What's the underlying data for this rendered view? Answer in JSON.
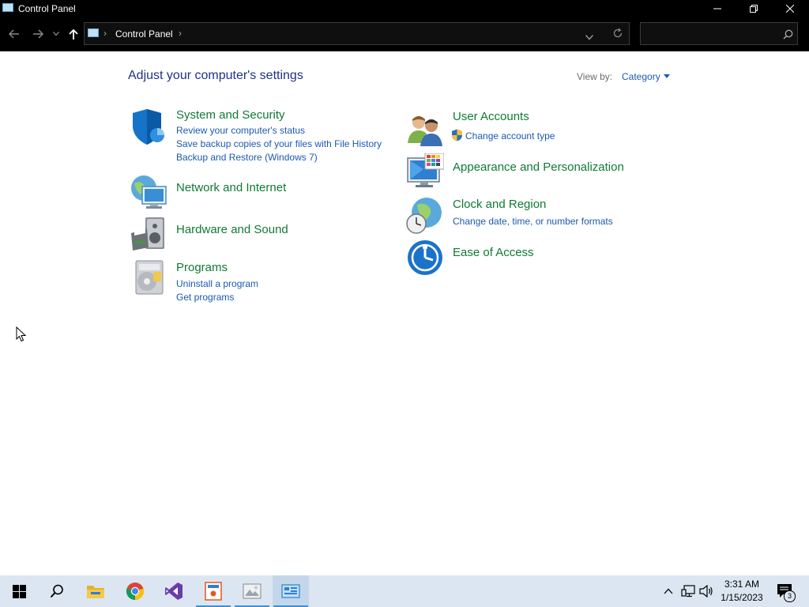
{
  "window": {
    "title": "Control Panel",
    "buttons": [
      "minimize",
      "restore",
      "close"
    ]
  },
  "address": {
    "crumb": "Control Panel",
    "search_placeholder": ""
  },
  "content": {
    "heading": "Adjust your computer's settings",
    "view_by_label": "View by:",
    "view_by_value": "Category",
    "left_categories": [
      {
        "title": "System and Security",
        "icon": "shield-icon",
        "links": [
          "Review your computer's status",
          "Save backup copies of your files with File History",
          "Backup and Restore (Windows 7)"
        ]
      },
      {
        "title": "Network and Internet",
        "icon": "network-globe-icon",
        "links": []
      },
      {
        "title": "Hardware and Sound",
        "icon": "printer-speaker-icon",
        "links": []
      },
      {
        "title": "Programs",
        "icon": "programs-disc-icon",
        "links": [
          "Uninstall a program",
          "Get programs"
        ]
      }
    ],
    "right_categories": [
      {
        "title": "User Accounts",
        "icon": "users-icon",
        "links": [
          "Change account type"
        ]
      },
      {
        "title": "Appearance and Personalization",
        "icon": "monitor-palette-icon",
        "links": []
      },
      {
        "title": "Clock and Region",
        "icon": "clock-globe-icon",
        "links": [
          "Change date, time, or number formats"
        ]
      },
      {
        "title": "Ease of Access",
        "icon": "ease-of-access-icon",
        "links": []
      }
    ]
  },
  "taskbar": {
    "apps": [
      "start-icon",
      "search-icon",
      "file-explorer-icon",
      "chrome-icon",
      "visual-studio-icon",
      "app-icon",
      "image-viewer-icon",
      "control-panel-icon"
    ],
    "time": "3:31 AM",
    "date": "1/15/2023",
    "notification_count": "3"
  },
  "colors": {
    "category_title": "#107a35",
    "link": "#1c59b0",
    "heading": "#1e3287",
    "titlebar": "#000000",
    "taskbar": "#dbe6f2"
  }
}
